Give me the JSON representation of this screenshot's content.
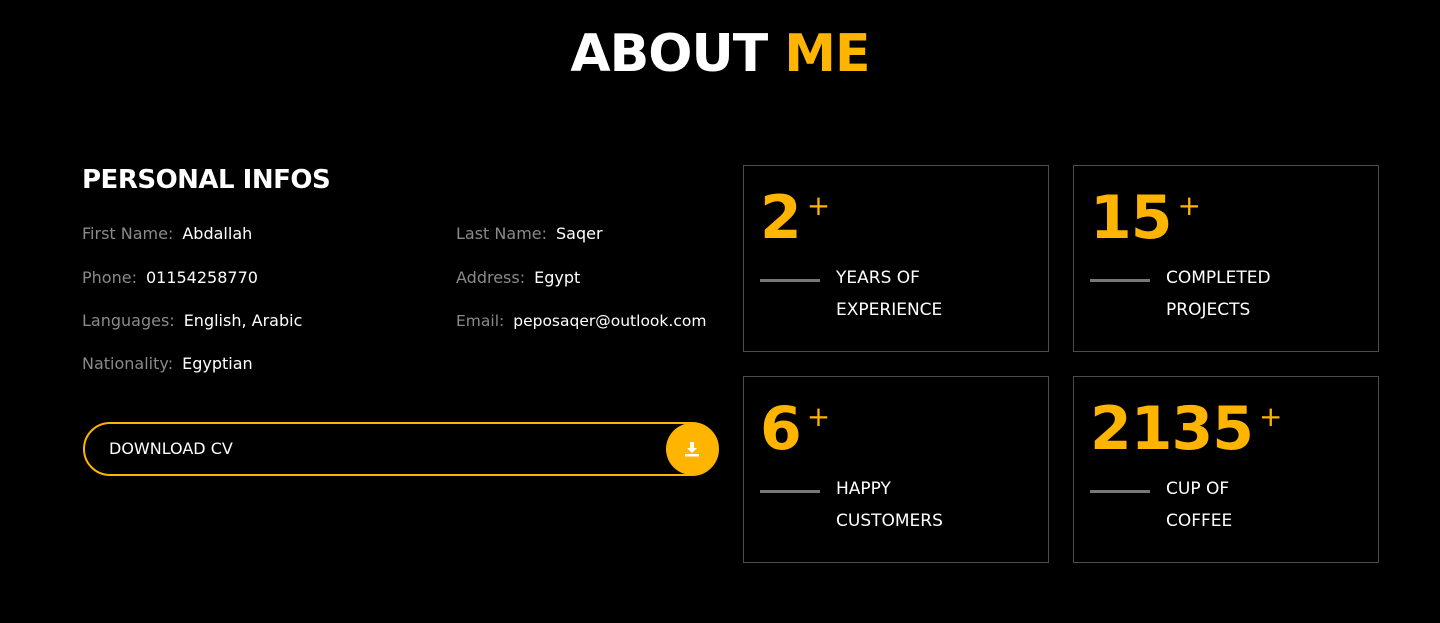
{
  "header": {
    "title_main": "ABOUT",
    "title_accent": "ME"
  },
  "personal": {
    "title": "PERSONAL INFOS",
    "first_name": {
      "label": "First Name:",
      "value": "Abdallah"
    },
    "last_name": {
      "label": "Last Name:",
      "value": "Saqer"
    },
    "phone": {
      "label": "Phone:",
      "value": "01154258770"
    },
    "address": {
      "label": "Address:",
      "value": "Egypt"
    },
    "languages": {
      "label": "Languages:",
      "value": "English, Arabic"
    },
    "email": {
      "label": "Email:",
      "value": "peposaqer@outlook.com"
    },
    "nationality": {
      "label": "Nationality:",
      "value": "Egyptian"
    }
  },
  "download": {
    "label": "DOWNLOAD CV",
    "icon": "download-icon"
  },
  "stats": [
    {
      "number": "2",
      "plus": "+",
      "line1": "YEARS OF",
      "line2": "EXPERIENCE"
    },
    {
      "number": "15",
      "plus": "+",
      "line1": "COMPLETED",
      "line2": "PROJECTS"
    },
    {
      "number": "6",
      "plus": "+",
      "line1": "HAPPY",
      "line2": "CUSTOMERS"
    },
    {
      "number": "2135",
      "plus": "+",
      "line1": "CUP OF",
      "line2": "COFFEE"
    }
  ],
  "colors": {
    "accent": "#ffb400",
    "background": "#000000",
    "label": "#8a8a8a",
    "border": "#4c4c4c"
  }
}
